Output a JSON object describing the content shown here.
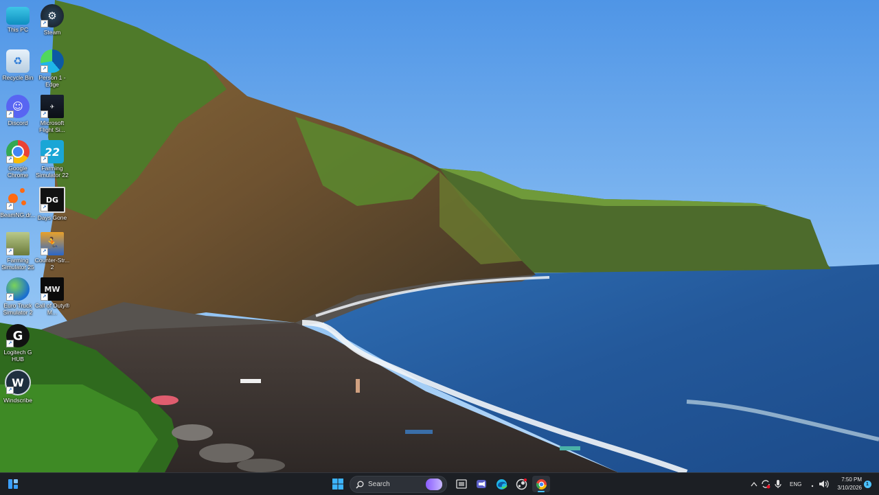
{
  "desktop": {
    "icons": [
      {
        "label": "This PC",
        "icon": "this-pc-icon"
      },
      {
        "label": "Steam",
        "icon": "steam-icon"
      },
      {
        "label": "Recycle Bin",
        "icon": "recycle-bin-icon"
      },
      {
        "label": "Person 1 - Edge",
        "icon": "edge-icon"
      },
      {
        "label": "Discord",
        "icon": "discord-icon"
      },
      {
        "label": "Microsoft Flight Si...",
        "icon": "flight-simulator-icon"
      },
      {
        "label": "Google Chrome",
        "icon": "chrome-icon"
      },
      {
        "label": "Farming Simulator 22",
        "icon": "farming-simulator-22-icon"
      },
      {
        "label": "BeamNG.dr...",
        "icon": "beamng-icon"
      },
      {
        "label": "Days Gone",
        "icon": "days-gone-icon"
      },
      {
        "label": "Farming Simulator 25",
        "icon": "farming-simulator-25-icon"
      },
      {
        "label": "Counter-Str... 2",
        "icon": "counter-strike-icon"
      },
      {
        "label": "Euro Truck Simulator 2",
        "icon": "euro-truck-icon"
      },
      {
        "label": "Call of Duty® M...",
        "icon": "call-of-duty-icon"
      },
      {
        "label": "Logitech G HUB",
        "icon": "logitech-icon"
      },
      {
        "label": "Windscribe",
        "icon": "windscribe-icon"
      }
    ]
  },
  "taskbar": {
    "search_placeholder": "Search",
    "language": "ENG",
    "time": "7:50 PM",
    "date": "3/10/2026",
    "notification_count": "1"
  },
  "colors": {
    "taskbar_bg": "#1c1f24",
    "accent": "#4cc2ff"
  }
}
